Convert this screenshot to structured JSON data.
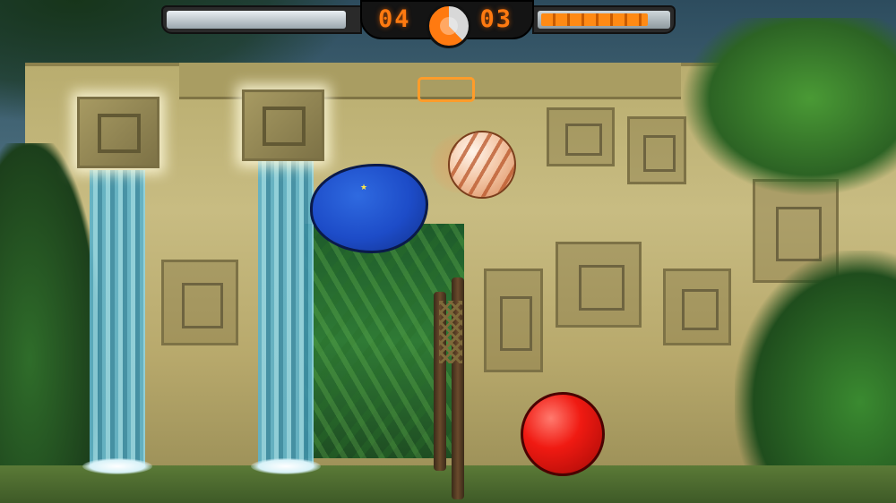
{
  "game": {
    "score_left": "04",
    "score_right": "03",
    "left_meter_fill": 0.95,
    "right_meter_fill": 0.85,
    "timer_remaining": 0.62
  },
  "colors": {
    "player_blue": "#1d4cc8",
    "player_red": "#f01a12",
    "hud_orange": "#ff7a10"
  },
  "icons": {
    "timer": "timer-dial-icon",
    "powerup": "crate-outline-icon"
  }
}
